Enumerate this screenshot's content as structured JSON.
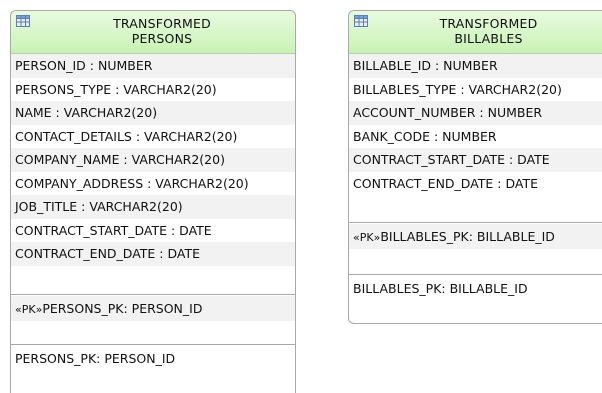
{
  "entities": [
    {
      "id": "persons",
      "title_line1": "TRANSFORMED",
      "title_line2": "PERSONS",
      "columns": [
        "PERSON_ID : NUMBER",
        "PERSONS_TYPE : VARCHAR2(20)",
        "NAME : VARCHAR2(20)",
        "CONTACT_DETAILS : VARCHAR2(20)",
        "COMPANY_NAME : VARCHAR2(20)",
        "COMPANY_ADDRESS : VARCHAR2(20)",
        "JOB_TITLE : VARCHAR2(20)",
        "CONTRACT_START_DATE : DATE",
        "CONTRACT_END_DATE : DATE"
      ],
      "pk_marker": "«PK»",
      "constraint": "PERSONS_PK: PERSON_ID",
      "index": "PERSONS_PK: PERSON_ID"
    },
    {
      "id": "billables",
      "title_line1": "TRANSFORMED",
      "title_line2": "BILLABLES",
      "columns": [
        "BILLABLE_ID : NUMBER",
        "BILLABLES_TYPE : VARCHAR2(20)",
        "ACCOUNT_NUMBER : NUMBER",
        "BANK_CODE : NUMBER",
        "CONTRACT_START_DATE : DATE",
        "CONTRACT_END_DATE : DATE"
      ],
      "pk_marker": "«PK»",
      "constraint": "BILLABLES_PK: BILLABLE_ID",
      "index": "BILLABLES_PK: BILLABLE_ID"
    }
  ],
  "colors": {
    "header_top": "#e9fbe0",
    "header_bottom": "#c8f2b4",
    "border": "#a9a9a9",
    "row_shade": "#f2f2f2"
  },
  "icons": {
    "header": "table-grid-icon"
  }
}
